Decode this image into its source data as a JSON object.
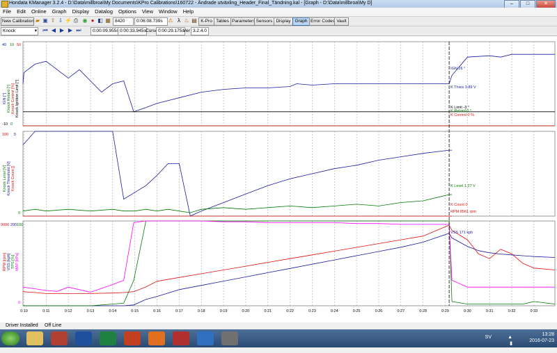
{
  "window": {
    "title": "Hondata KManager 3.2.4 - D:\\Data\\millbroa\\My Documents\\KPro Calibrations\\160722 - Ändrade utväxling_Header_Final_Tändning.kal - [Graph - D:\\Data\\millbroa\\My D]",
    "minimize": "–",
    "maximize": "□",
    "close": "✕"
  },
  "menu": [
    "File",
    "Edit",
    "Online",
    "Graph",
    "Display",
    "Datalog",
    "Options",
    "View",
    "Window",
    "Help"
  ],
  "toolbar1": {
    "new_calibration": "New Calibration",
    "value1": "8420",
    "value2": "0:06:08.739s",
    "buttons": [
      "K-Pro",
      "Tables",
      "Parameters",
      "Sensors",
      "Display",
      "Graph",
      "Error Codes",
      "Vault"
    ],
    "active": "Graph"
  },
  "toolbar2": {
    "dropdown": "Knock",
    "start_time": "0:00:09.955s",
    "end_time": "0:00:33.945s",
    "cursor_label": "Cursor",
    "cursor_time": "0:00:29.175s",
    "ver_label": "Ver",
    "version": "3.2.4.0"
  },
  "status": {
    "driver": "Driver Installed",
    "line": "Off Line"
  },
  "taskbar": {
    "lang": "SV",
    "time": "13:28",
    "date": "2016-07-23"
  },
  "colors": {
    "blue": "#1a1aa0",
    "green": "#007a00",
    "red": "#e01010",
    "magenta": "#ff00ff",
    "black": "#000000"
  },
  "chart_data": [
    {
      "type": "line",
      "panel": "top",
      "y_left_labels": [
        "IGN [°]",
        "Knock Retard [°]",
        "Knock Control [%]",
        "Knock Ignition Limit [°]"
      ],
      "ticks_left": [
        "40",
        "10",
        "50",
        "0",
        "-10"
      ],
      "x": [
        9.955,
        10.0,
        10.5,
        11.0,
        11.5,
        12.0,
        12.5,
        13.0,
        13.5,
        14.0,
        14.5,
        14.95,
        15.5,
        16.0,
        17.0,
        18.0,
        19.0,
        20.0,
        21.0,
        22.0,
        22.3,
        23.0,
        24.0,
        25.0,
        26.0,
        27.0,
        28.0,
        29.175,
        29.3,
        30.0,
        31.0,
        31.5,
        32.0,
        33.0,
        33.945
      ],
      "series": [
        {
          "name": "IGN",
          "color": "blue",
          "values": [
            20,
            28,
            34,
            36,
            30,
            24,
            30,
            22,
            14,
            20,
            22,
            0,
            3,
            6,
            10,
            14,
            16,
            17,
            17,
            18,
            20,
            19,
            20,
            20,
            20,
            20,
            20,
            20,
            26,
            39,
            40,
            39,
            41,
            41,
            41
          ]
        },
        {
          "name": "K Limit",
          "color": "black",
          "values": [
            0,
            0,
            0,
            0,
            0,
            0,
            0,
            0,
            0,
            0,
            0,
            0,
            0,
            0,
            0,
            0,
            0,
            0,
            0,
            0,
            0,
            0,
            0,
            0,
            0,
            0,
            0,
            0,
            0,
            0,
            0,
            0,
            0,
            0,
            0
          ]
        },
        {
          "name": "K Retard",
          "color": "green",
          "values": [
            0,
            0,
            0,
            0,
            0,
            0,
            0,
            0,
            0,
            0,
            0,
            0,
            0,
            0,
            0,
            0,
            0,
            0,
            0,
            0,
            0,
            0,
            0,
            0,
            0,
            0,
            0,
            0,
            0,
            0,
            0,
            0,
            0,
            0,
            0
          ]
        },
        {
          "name": "K Control",
          "color": "red",
          "values": [
            0,
            0,
            0,
            0,
            0,
            0,
            0,
            0,
            0,
            0,
            0,
            0,
            0,
            0,
            0,
            0,
            0,
            0,
            0,
            0,
            0,
            0,
            0,
            0,
            0,
            0,
            0,
            0,
            0,
            0,
            0,
            0,
            0,
            0,
            0
          ]
        }
      ],
      "legend_labels": [
        {
          "text": "IGN 26 °",
          "color": "blue"
        },
        {
          "text": "K Limit -3 °",
          "color": "black"
        },
        {
          "text": "K Retard 0 °",
          "color": "green"
        },
        {
          "text": "K Control 0 %",
          "color": "red"
        }
      ]
    },
    {
      "type": "line",
      "panel": "middle",
      "y_left_labels": [
        "Knock Level [V]",
        "Knock Threshold [V]",
        "Knock Count []"
      ],
      "ticks_left": [
        "100",
        "5",
        "0"
      ],
      "x": [
        9.955,
        10.5,
        11.0,
        12.0,
        13.0,
        14.0,
        14.5,
        15.0,
        15.5,
        16.0,
        16.5,
        17.0,
        17.5,
        18.0,
        19.0,
        20.0,
        21.0,
        22.0,
        23.0,
        24.0,
        25.0,
        26.0,
        27.0,
        28.0,
        29.175,
        29.3
      ],
      "series": [
        {
          "name": "K Thres",
          "color": "blue",
          "values": [
            4.2,
            5.0,
            5.0,
            5.0,
            5.0,
            5.0,
            1.0,
            1.4,
            1.8,
            2.4,
            3.1,
            3.1,
            0.0,
            0.3,
            0.8,
            1.3,
            1.8,
            2.2,
            2.5,
            2.8,
            3.0,
            3.3,
            3.5,
            3.7,
            3.89,
            3.89
          ]
        },
        {
          "name": "K Level",
          "color": "green",
          "values": [
            0.3,
            0.4,
            0.3,
            0.4,
            0.3,
            0.4,
            0.3,
            0.3,
            0.4,
            0.3,
            0.4,
            0.3,
            0.2,
            0.4,
            0.5,
            0.4,
            0.5,
            0.6,
            0.5,
            0.6,
            0.7,
            0.6,
            0.8,
            0.9,
            1.27,
            1.27
          ]
        },
        {
          "name": "K Count",
          "color": "red",
          "values": [
            0,
            0,
            0,
            0,
            0,
            0,
            0,
            0,
            0,
            0,
            0,
            0,
            0,
            0,
            0,
            0,
            0,
            0,
            0,
            0,
            0,
            0,
            0,
            0,
            0,
            0
          ]
        }
      ],
      "legend_labels": [
        {
          "text": "K Thres 3.89 V",
          "color": "blue"
        },
        {
          "text": "K Level 1.27 V",
          "color": "green"
        },
        {
          "text": "K Count 0",
          "color": "red"
        }
      ]
    },
    {
      "type": "line",
      "panel": "bottom",
      "y_left_labels": [
        "RPM [rpm]",
        "VSS [kph]",
        "TPS [%]",
        "MAP [kPa]"
      ],
      "ticks_left": [
        "9000",
        "200",
        "100",
        "0"
      ],
      "x_tick_labels": [
        "0:10",
        "0:11",
        "0:12",
        "0:13",
        "0:14",
        "0:15",
        "0:16",
        "0:17",
        "0:18",
        "0:19",
        "0:20",
        "0:21",
        "0:22",
        "0:23",
        "0:24",
        "0:25",
        "0:26",
        "0:27",
        "0:28",
        "0:29",
        "0:30",
        "0:31",
        "0:32",
        "0:33"
      ],
      "x": [
        9.955,
        10.5,
        11.0,
        11.5,
        12.0,
        13.0,
        14.0,
        14.5,
        14.95,
        15.5,
        16.0,
        17.0,
        18.0,
        19.0,
        20.0,
        21.0,
        22.0,
        23.0,
        24.0,
        25.0,
        26.0,
        27.0,
        28.0,
        29.175,
        29.3,
        30.0,
        30.5,
        31.0,
        31.5,
        32.0,
        32.5,
        33.0,
        33.945
      ],
      "series": [
        {
          "name": "RPM",
          "color": "red",
          "values": [
            1500,
            1400,
            1300,
            1300,
            1300,
            1300,
            1350,
            1400,
            1500,
            2000,
            2600,
            3000,
            3400,
            3800,
            4200,
            4600,
            5000,
            5400,
            5800,
            6200,
            6600,
            7000,
            7400,
            8561,
            8000,
            7000,
            5500,
            5000,
            6000,
            5500,
            4500,
            4000,
            3800
          ]
        },
        {
          "name": "VSS",
          "color": "blue",
          "values": [
            0,
            0,
            0,
            0,
            0,
            0,
            0,
            0,
            2,
            15,
            22,
            38,
            48,
            58,
            68,
            78,
            88,
            98,
            108,
            118,
            128,
            138,
            150,
            171,
            160,
            140,
            130,
            125,
            122,
            120,
            118,
            116,
            114
          ]
        },
        {
          "name": "TPS",
          "color": "green",
          "values": [
            0,
            0,
            0,
            0,
            0,
            0,
            2,
            3,
            30,
            100,
            100,
            100,
            100,
            100,
            100,
            100,
            100,
            100,
            100,
            100,
            100,
            100,
            100,
            100,
            5,
            2,
            2,
            2,
            2,
            2,
            2,
            5,
            2
          ]
        },
        {
          "name": "MAP",
          "color": "magenta",
          "values": [
            22,
            20,
            18,
            17,
            22,
            16,
            25,
            30,
            98,
            100,
            100,
            100,
            100,
            99,
            99,
            98,
            98,
            98,
            98,
            97,
            97,
            96,
            96,
            96,
            30,
            22,
            22,
            22,
            22,
            22,
            22,
            22,
            22
          ]
        }
      ],
      "legend_labels": [
        {
          "text": "RPM 8561 rpm",
          "color": "red"
        },
        {
          "text": "VSS 171 kph",
          "color": "blue"
        }
      ]
    }
  ]
}
